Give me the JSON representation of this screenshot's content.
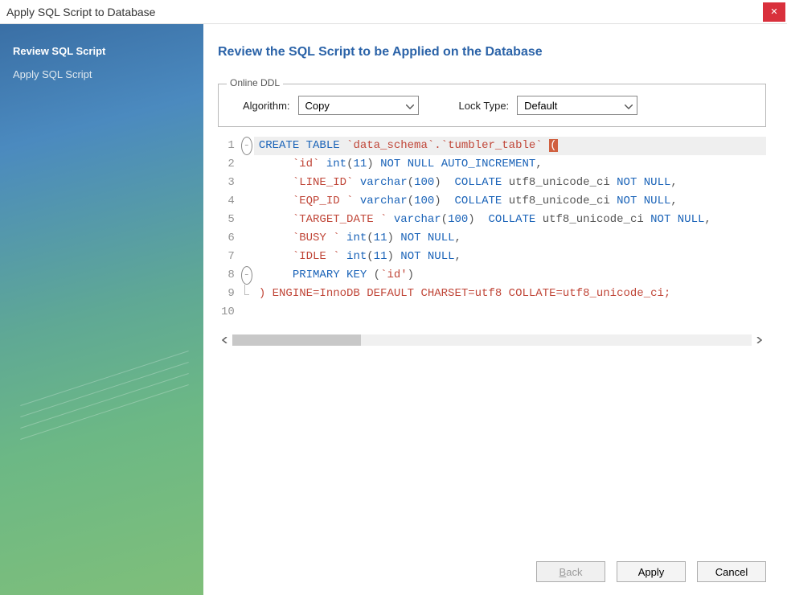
{
  "window": {
    "title": "Apply SQL Script to Database"
  },
  "sidebar": {
    "items": [
      {
        "label": "Review SQL Script",
        "active": true
      },
      {
        "label": "Apply SQL Script",
        "active": false
      }
    ]
  },
  "main": {
    "heading": "Review the SQL Script to be Applied on the Database",
    "ddl_group": {
      "legend": "Online DDL",
      "algorithm_label": "Algorithm:",
      "algorithm_value": "Copy",
      "locktype_label": "Lock Type:",
      "locktype_value": "Default"
    },
    "code": {
      "lines": [
        {
          "n": 1,
          "fold": "open",
          "hl": true,
          "segments": [
            {
              "t": "CREATE TABLE",
              "c": "kw-blue"
            },
            {
              "t": " ",
              "c": ""
            },
            {
              "t": "`data_schema`.`tumbler_table`",
              "c": "kw-red"
            },
            {
              "t": " ",
              "c": ""
            },
            {
              "t": "(",
              "c": "paren-hl"
            }
          ]
        },
        {
          "n": 2,
          "indent": "     ",
          "segments": [
            {
              "t": "`id`",
              "c": "kw-red"
            },
            {
              "t": " ",
              "c": ""
            },
            {
              "t": "int",
              "c": "kw-blue"
            },
            {
              "t": "(",
              "c": "kw-grey"
            },
            {
              "t": "11",
              "c": "kw-blue"
            },
            {
              "t": ") ",
              "c": "kw-grey"
            },
            {
              "t": "NOT NULL AUTO_INCREMENT",
              "c": "kw-blue"
            },
            {
              "t": ",",
              "c": "kw-grey"
            }
          ]
        },
        {
          "n": 3,
          "indent": "     ",
          "segments": [
            {
              "t": "`LINE_ID`",
              "c": "kw-red"
            },
            {
              "t": " ",
              "c": ""
            },
            {
              "t": "varchar",
              "c": "kw-blue"
            },
            {
              "t": "(",
              "c": "kw-grey"
            },
            {
              "t": "100",
              "c": "kw-blue"
            },
            {
              "t": ")  ",
              "c": "kw-grey"
            },
            {
              "t": "COLLATE",
              "c": "kw-blue"
            },
            {
              "t": " utf8_unicode_ci ",
              "c": "kw-grey"
            },
            {
              "t": "NOT NULL",
              "c": "kw-blue"
            },
            {
              "t": ",",
              "c": "kw-grey"
            }
          ]
        },
        {
          "n": 4,
          "indent": "     ",
          "segments": [
            {
              "t": "`EQP_ID `",
              "c": "kw-red"
            },
            {
              "t": " ",
              "c": ""
            },
            {
              "t": "varchar",
              "c": "kw-blue"
            },
            {
              "t": "(",
              "c": "kw-grey"
            },
            {
              "t": "100",
              "c": "kw-blue"
            },
            {
              "t": ")  ",
              "c": "kw-grey"
            },
            {
              "t": "COLLATE",
              "c": "kw-blue"
            },
            {
              "t": " utf8_unicode_ci ",
              "c": "kw-grey"
            },
            {
              "t": "NOT NULL",
              "c": "kw-blue"
            },
            {
              "t": ",",
              "c": "kw-grey"
            }
          ]
        },
        {
          "n": 5,
          "indent": "     ",
          "segments": [
            {
              "t": "`TARGET_DATE `",
              "c": "kw-red"
            },
            {
              "t": " ",
              "c": ""
            },
            {
              "t": "varchar",
              "c": "kw-blue"
            },
            {
              "t": "(",
              "c": "kw-grey"
            },
            {
              "t": "100",
              "c": "kw-blue"
            },
            {
              "t": ")  ",
              "c": "kw-grey"
            },
            {
              "t": "COLLATE",
              "c": "kw-blue"
            },
            {
              "t": " utf8_unicode_ci ",
              "c": "kw-grey"
            },
            {
              "t": "NOT NULL",
              "c": "kw-blue"
            },
            {
              "t": ",",
              "c": "kw-grey"
            }
          ]
        },
        {
          "n": 6,
          "indent": "     ",
          "segments": [
            {
              "t": "`BUSY `",
              "c": "kw-red"
            },
            {
              "t": " ",
              "c": ""
            },
            {
              "t": "int",
              "c": "kw-blue"
            },
            {
              "t": "(",
              "c": "kw-grey"
            },
            {
              "t": "11",
              "c": "kw-blue"
            },
            {
              "t": ") ",
              "c": "kw-grey"
            },
            {
              "t": "NOT NULL",
              "c": "kw-blue"
            },
            {
              "t": ",",
              "c": "kw-grey"
            }
          ]
        },
        {
          "n": 7,
          "indent": "     ",
          "segments": [
            {
              "t": "`IDLE `",
              "c": "kw-red"
            },
            {
              "t": " ",
              "c": ""
            },
            {
              "t": "int",
              "c": "kw-blue"
            },
            {
              "t": "(",
              "c": "kw-grey"
            },
            {
              "t": "11",
              "c": "kw-blue"
            },
            {
              "t": ") ",
              "c": "kw-grey"
            },
            {
              "t": "NOT NULL",
              "c": "kw-blue"
            },
            {
              "t": ",",
              "c": "kw-grey"
            }
          ]
        },
        {
          "n": 8,
          "fold": "open",
          "indent": "     ",
          "segments": [
            {
              "t": "PRIMARY KEY",
              "c": "kw-blue"
            },
            {
              "t": " (",
              "c": "kw-grey"
            },
            {
              "t": "`id'",
              "c": "kw-red"
            },
            {
              "t": ")",
              "c": "kw-grey"
            }
          ]
        },
        {
          "n": 9,
          "fold": "branch",
          "segments": [
            {
              "t": ") ENGINE=InnoDB DEFAULT CHARSET=utf8 COLLATE=utf8_unicode_ci;",
              "c": "kw-red"
            }
          ]
        },
        {
          "n": 10,
          "segments": []
        }
      ]
    }
  },
  "footer": {
    "back": "Back",
    "apply": "Apply",
    "cancel": "Cancel"
  }
}
